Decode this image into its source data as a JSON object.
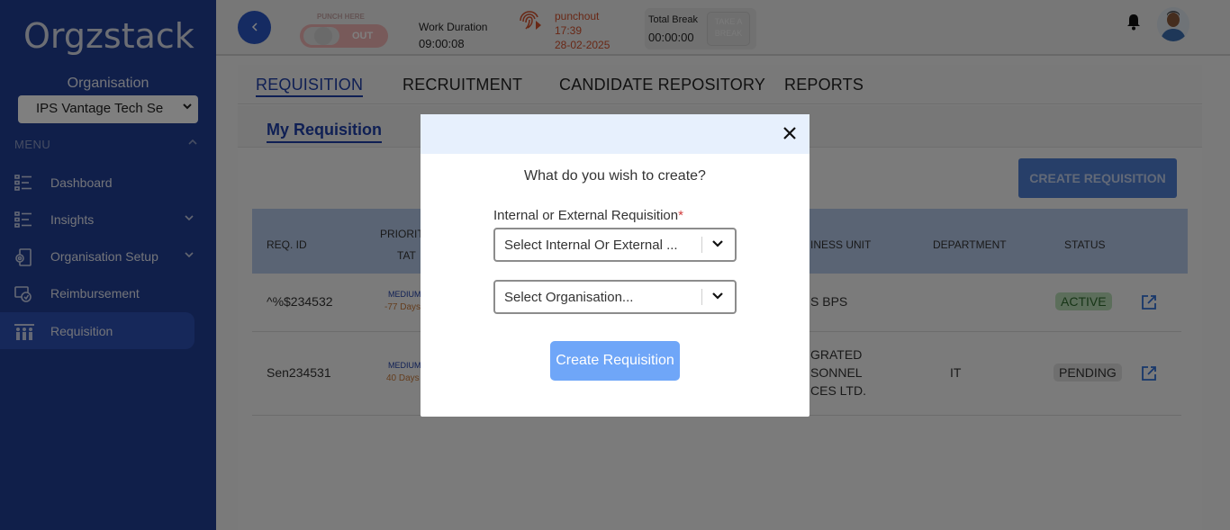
{
  "sidebar": {
    "logo": "Orgzstack",
    "org_label": "Organisation",
    "org_selected": "IPS Vantage Tech Se",
    "menu_label": "MENU",
    "items": [
      {
        "label": "Dashboard",
        "icon": "dashboard-icon"
      },
      {
        "label": "Insights",
        "icon": "insights-icon"
      },
      {
        "label": "Organisation Setup",
        "icon": "organisation-setup-icon"
      },
      {
        "label": "Reimbursement",
        "icon": "reimbursement-icon"
      },
      {
        "label": "Requisition",
        "icon": "requisition-icon"
      }
    ]
  },
  "header": {
    "punch_here": "PUNCH HERE",
    "punch_state": "OUT",
    "work_duration_label": "Work Duration",
    "work_duration_value": "09:00:08",
    "punch_type": "punchout",
    "punch_time": "17:39",
    "punch_date": "28-02-2025",
    "total_break_label": "Total Break",
    "total_break_value": "00:00:00",
    "take_break_line1": "TAKE A",
    "take_break_line2": "BREAK"
  },
  "tabs": [
    "REQUISITION",
    "RECRUITMENT",
    "CANDIDATE REPOSITORY",
    "REPORTS"
  ],
  "subtab": "My Requisition",
  "create_button": "CREATE REQUISITION",
  "table": {
    "headers": {
      "req_id": "REQ. ID",
      "priority": "PRIORIT",
      "tat": "TAT",
      "business_unit": "INESS UNIT",
      "department": "DEPARTMENT",
      "status": "STATUS"
    },
    "rows": [
      {
        "req_id": "^%$234532",
        "priority": "MEDIUM",
        "tat": "-77 Days",
        "bu_line1": "S BPS",
        "bu_line2": "",
        "bu_line3": "",
        "department": "",
        "status": "ACTIVE"
      },
      {
        "req_id": "Sen234531",
        "priority": "MEDIUM",
        "tat": "40 Days",
        "bu_line1": "GRATED",
        "bu_line2": "SONNEL",
        "bu_line3": "CES LTD.",
        "department": "IT",
        "status": "PENDING"
      }
    ]
  },
  "modal": {
    "question": "What do you wish to create?",
    "field_label": "Internal or External Requisition",
    "required_mark": "*",
    "select1_placeholder": "Select Internal Or External ...",
    "select2_placeholder": "Select Organisation...",
    "create_button": "Create Requisition",
    "close_glyph": "✕"
  },
  "colors": {
    "sidebar": "#213e95",
    "accent": "#1f3fa8",
    "modal_button": "#6fa6f8",
    "punch_red": "#d2502c"
  }
}
